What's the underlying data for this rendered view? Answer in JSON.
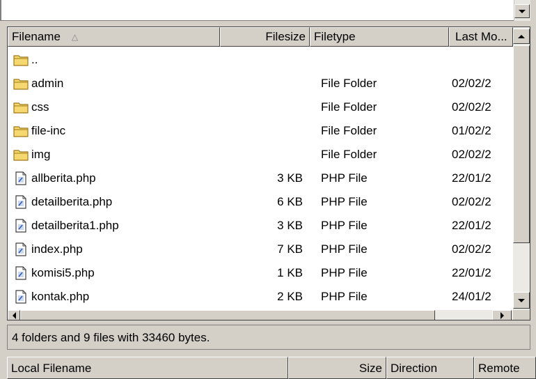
{
  "file_list": {
    "columns": {
      "filename": "Filename",
      "filesize": "Filesize",
      "filetype": "Filetype",
      "last_modified": "Last Mo..."
    },
    "sort_indicator": "△",
    "rows": [
      {
        "name": "..",
        "size": "",
        "type": "",
        "date": "",
        "icon": "folder-icon"
      },
      {
        "name": "admin",
        "size": "",
        "type": "File Folder",
        "date": "02/02/2",
        "icon": "folder-icon"
      },
      {
        "name": "css",
        "size": "",
        "type": "File Folder",
        "date": "02/02/2",
        "icon": "folder-icon"
      },
      {
        "name": "file-inc",
        "size": "",
        "type": "File Folder",
        "date": "01/02/2",
        "icon": "folder-icon"
      },
      {
        "name": "img",
        "size": "",
        "type": "File Folder",
        "date": "02/02/2",
        "icon": "folder-icon"
      },
      {
        "name": "allberita.php",
        "size": "3 KB",
        "type": "PHP File",
        "date": "22/01/2",
        "icon": "php-file-icon"
      },
      {
        "name": "detailberita.php",
        "size": "6 KB",
        "type": "PHP File",
        "date": "02/02/2",
        "icon": "php-file-icon"
      },
      {
        "name": "detailberita1.php",
        "size": "3 KB",
        "type": "PHP File",
        "date": "22/01/2",
        "icon": "php-file-icon"
      },
      {
        "name": "index.php",
        "size": "7 KB",
        "type": "PHP File",
        "date": "02/02/2",
        "icon": "php-file-icon"
      },
      {
        "name": "komisi5.php",
        "size": "1 KB",
        "type": "PHP File",
        "date": "22/01/2",
        "icon": "php-file-icon"
      },
      {
        "name": "kontak.php",
        "size": "2 KB",
        "type": "PHP File",
        "date": "24/01/2",
        "icon": "php-file-icon"
      }
    ]
  },
  "status": {
    "text": "4 folders and 9 files with 33460 bytes."
  },
  "queue": {
    "columns": {
      "local_filename": "Local Filename",
      "size": "Size",
      "direction": "Direction",
      "remote": "Remote"
    }
  },
  "colors": {
    "window_bg": "#d4d0c8",
    "list_bg": "#ffffff",
    "folder_fill": "#f5d870",
    "folder_outline": "#a07818",
    "php_icon_accent": "#2f5fb4"
  }
}
